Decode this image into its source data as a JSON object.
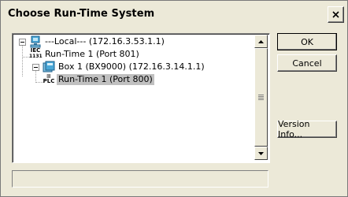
{
  "window": {
    "title": "Choose Run-Time System"
  },
  "tree": {
    "nodes": [
      {
        "label": "---Local---   (172.16.3.53.1.1)",
        "icon": "computer-icon",
        "expanded": true
      },
      {
        "label": "Run-Time 1 (Port 801)",
        "icon": "iec-runtime-icon"
      },
      {
        "label": "Box 1 (BX9000)   (172.16.3.14.1.1)",
        "icon": "box-device-icon",
        "expanded": true
      },
      {
        "label": "Run-Time 1 (Port 800)",
        "icon": "plc-runtime-icon",
        "selected": true
      }
    ],
    "icon_text": {
      "iec": "IEC",
      "plc": "PLC"
    }
  },
  "buttons": {
    "ok": "OK",
    "cancel": "Cancel",
    "version_info": "Version Info..."
  },
  "colors": {
    "dialog_bg": "#ece9d8",
    "selection_bg": "#c0c0c0"
  }
}
